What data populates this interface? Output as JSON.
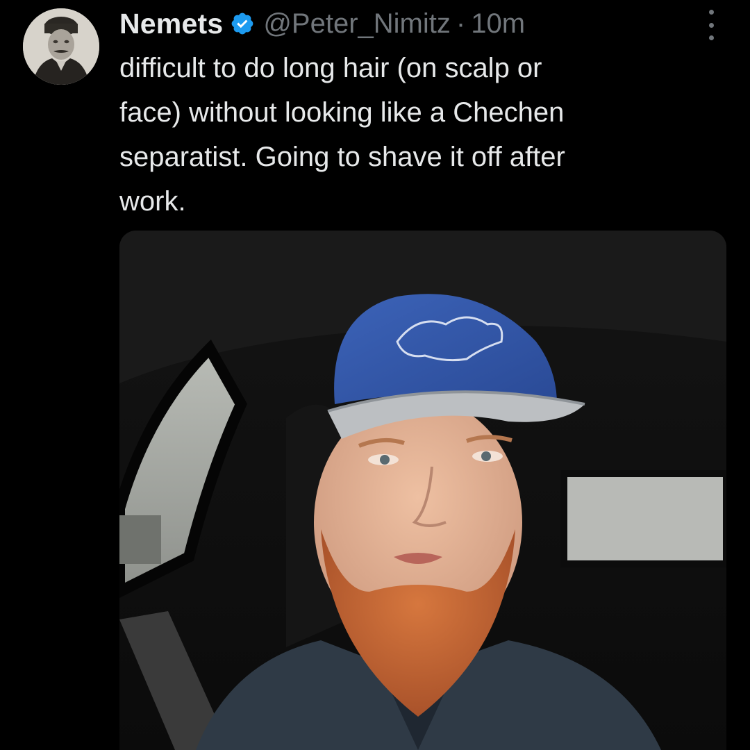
{
  "tweet": {
    "author": {
      "display_name": "Nemets",
      "verified": true,
      "handle": "@Peter_Nimitz",
      "avatar_icon": "vintage-portrait-avatar"
    },
    "separator": "·",
    "time_ago": "10m",
    "more_icon": "more-options-icon",
    "text_lines": [
      "difficult to do long hair (on scalp or",
      "face) without looking like a Chechen",
      "separatist. Going to shave it off after",
      "work."
    ],
    "media": {
      "kind": "photo"
    }
  },
  "colors": {
    "background": "#000000",
    "text_primary": "#e7e9ea",
    "text_secondary": "#71767b",
    "verified_blue": "#1d9bf0"
  }
}
